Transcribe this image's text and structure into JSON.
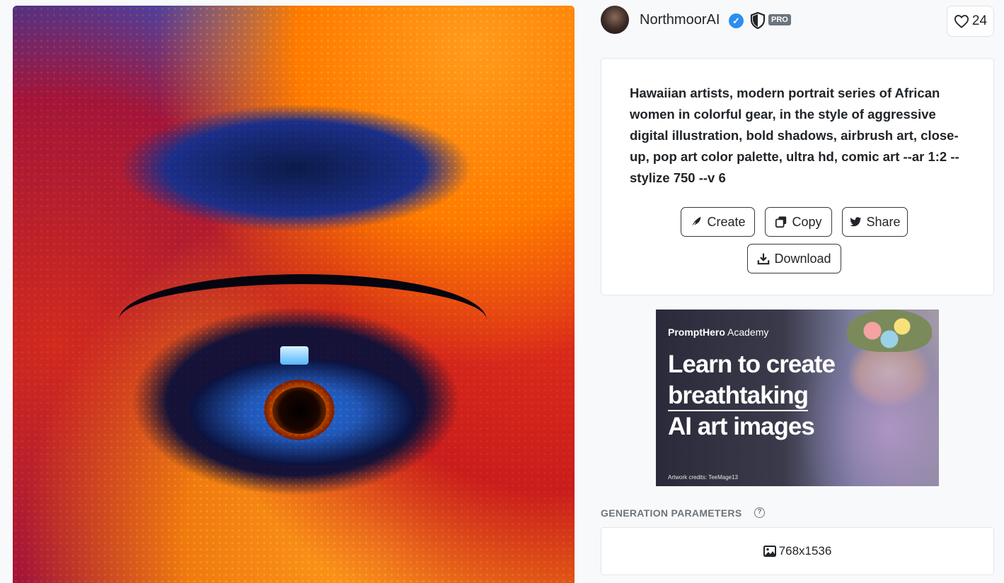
{
  "author": {
    "name": "NorthmoorAI",
    "badge": "PRO"
  },
  "likes": {
    "count": "24"
  },
  "prompt": {
    "text": "Hawaiian artists, modern portrait series of African women in colorful gear, in the style of aggressive digital illustration, bold shadows, airbrush art, close-up, pop art color palette, ultra hd, comic art --ar 1:2 --stylize 750 --v 6"
  },
  "actions": {
    "create": "Create",
    "copy": "Copy",
    "share": "Share",
    "download": "Download"
  },
  "ad": {
    "brand_bold": "PromptHero",
    "brand_rest": " Academy",
    "headline_1": "Learn to create",
    "headline_2": "breathtaking",
    "headline_3": "AI art images",
    "credit": "Artwork credits: TeeMage13"
  },
  "params": {
    "title": "GENERATION PARAMETERS",
    "help": "?",
    "dimensions": "768x1536"
  },
  "icons": {
    "verified": "check-badge",
    "shield": "shield-half",
    "heart": "heart-outline",
    "create": "feather",
    "copy": "copy",
    "share": "twitter-bird",
    "download": "download",
    "dimensions": "image"
  },
  "colors": {
    "verified_blue": "#2b8ef0",
    "badge_gray": "#6c757d",
    "button_border": "#343a40"
  }
}
